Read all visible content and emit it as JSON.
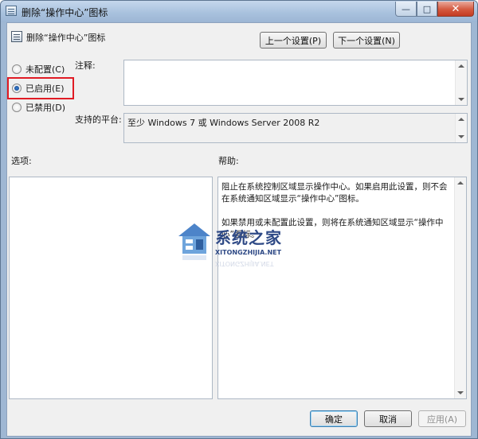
{
  "window": {
    "title": "删除“操作中心”图标",
    "controls": {
      "minimize": "—",
      "maximize": "□",
      "close": "✕"
    }
  },
  "header": {
    "policy_name": "删除“操作中心”图标",
    "prev_button": "上一个设置(P)",
    "next_button": "下一个设置(N)"
  },
  "state": {
    "options": [
      {
        "label": "未配置(C)",
        "selected": false
      },
      {
        "label": "已启用(E)",
        "selected": true
      },
      {
        "label": "已禁用(D)",
        "selected": false
      }
    ]
  },
  "comment": {
    "label": "注释:",
    "value": ""
  },
  "platform": {
    "label": "支持的平台:",
    "value": "至少 Windows 7 或 Windows Server 2008 R2"
  },
  "options_section": {
    "label": "选项:"
  },
  "help_section": {
    "label": "帮助:",
    "paragraphs": [
      " 阻止在系统控制区域显示操作中心。如果启用此设置，则不会在系统通知区域显示“操作中心”图标。",
      "如果禁用或未配置此设置，则将在系统通知区域显示“操作中心”图标。"
    ]
  },
  "watermark": {
    "brand": "系统之家",
    "domain": "XITONGZHIJIA.NET"
  },
  "footer": {
    "ok": "确定",
    "cancel": "取消",
    "apply": "应用(A)"
  },
  "colors": {
    "highlight": "#e01b24",
    "accent": "#3c7fb1",
    "titlebar": "#a9c2de"
  },
  "icons": {
    "window": "policy-document-icon",
    "close": "close-icon"
  }
}
